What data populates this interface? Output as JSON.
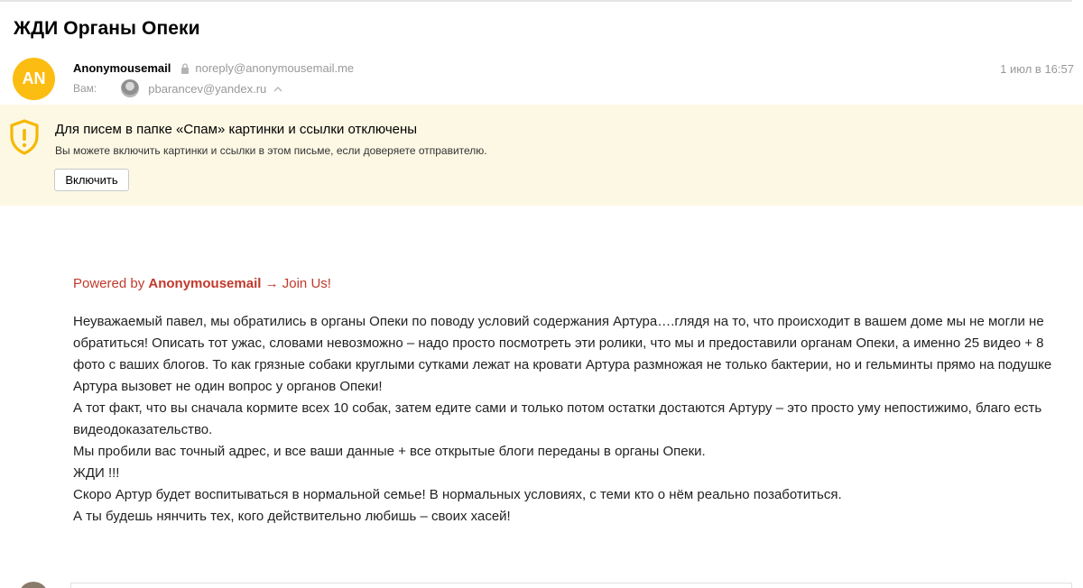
{
  "subject": "ЖДИ Органы Опеки",
  "sender": {
    "avatar_initials": "AN",
    "name": "Anonymousemail",
    "email": "noreply@anonymousemail.me",
    "date": "1 июл в 16:57"
  },
  "recipient": {
    "label": "Вам:",
    "email": "pbarancev@yandex.ru"
  },
  "spam_banner": {
    "title": "Для писем в папке «Спам» картинки и ссылки отключены",
    "text": "Вы можете включить картинки и ссылки в этом письме, если доверяете отправителю.",
    "button_label": "Включить"
  },
  "powered": {
    "prefix": "Powered by ",
    "brand": "Anonymousemail",
    "suffix": " → Join Us!"
  },
  "body_lines": [
    "Неуважаемый павел, мы обратились в органы Опеки по поводу условий содержания Артура….глядя на то, что происходит в вашем доме мы не могли не обратиться! Описать тот ужас, словами невозможно – надо просто посмотреть эти ролики, что мы и предоставили органам Опеки, а именно 25 видео + 8 фото с ваших блогов. То как грязные собаки круглыми сутками лежат на кровати Артура размножая не только бактерии, но и гельминты прямо на подушке Артура вызовет не один вопрос у органов Опеки!",
    "А тот факт, что вы сначала кормите всех 10 собак, затем едите сами и только потом остатки достаются Артуру – это просто уму непостижимо, благо есть видеодоказательство.",
    "Мы пробили вас точный адрес, и все ваши данные + все открытые блоги переданы в органы Опеки.",
    "ЖДИ !!!",
    "Скоро Артур будет воспитываться в нормальной семье! В нормальных условиях, с теми кто о нём реально позаботиться.",
    "А ты будешь нянчить тех, кого действительно любишь – своих  хасей!"
  ],
  "colors": {
    "avatar": "#fcbd12",
    "banner_bg": "#fdf8e4",
    "warning_icon": "#f5b800",
    "powered_link": "#c0392b"
  },
  "icons": [
    "lock-icon",
    "chevron-up-icon",
    "shield-warning-icon"
  ]
}
